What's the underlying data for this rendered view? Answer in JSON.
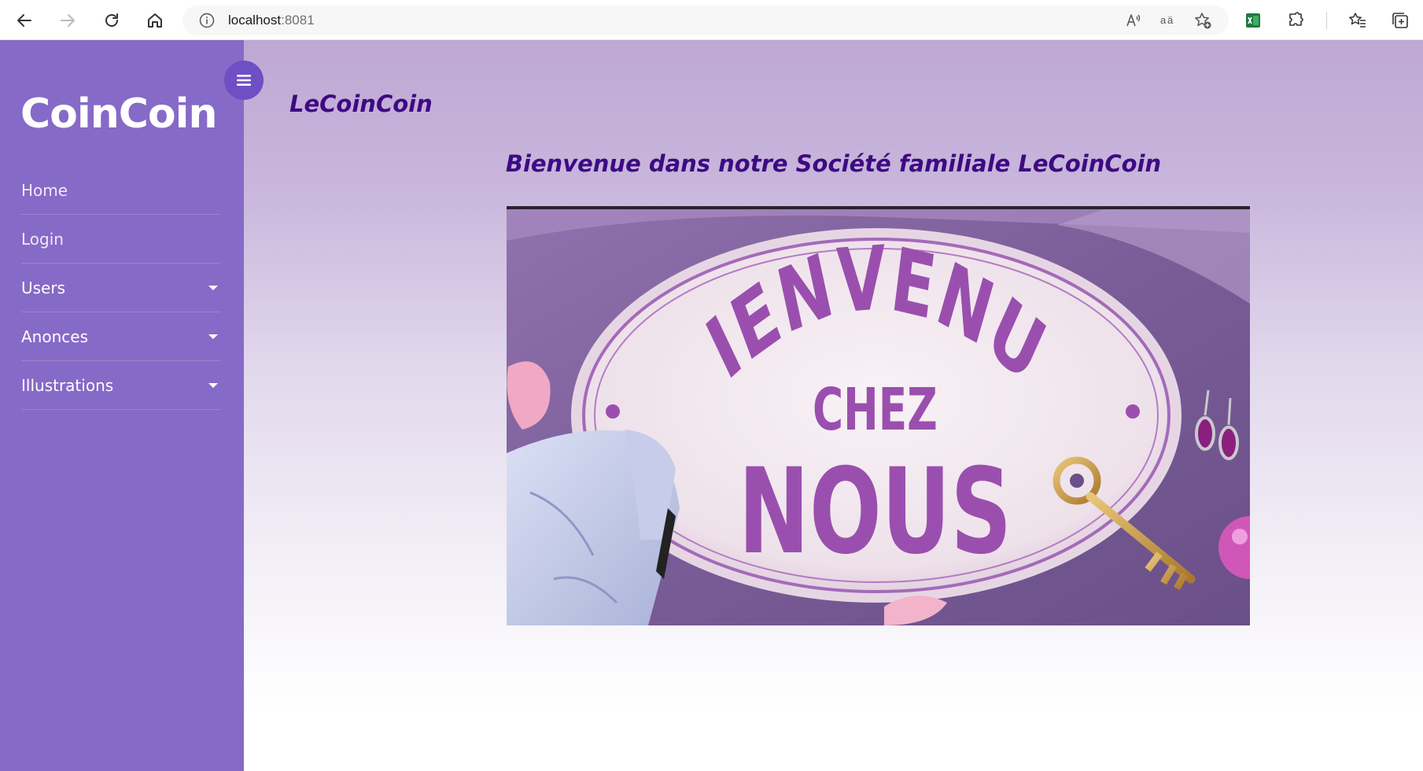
{
  "browser": {
    "url_host": "localhost",
    "url_port": ":8081",
    "read_aloud_label": "A’’",
    "translate_label": "aä"
  },
  "sidebar": {
    "brand": "CoinCoin",
    "items": [
      {
        "label": "Home",
        "has_dropdown": false
      },
      {
        "label": "Login",
        "has_dropdown": false
      },
      {
        "label": "Users",
        "has_dropdown": true
      },
      {
        "label": "Anonces",
        "has_dropdown": true
      },
      {
        "label": "Illustrations",
        "has_dropdown": true
      }
    ]
  },
  "main": {
    "site_title": "LeCoinCoin",
    "welcome": "Bienvenue dans notre Société familiale LeCoinCoin",
    "hero": {
      "line1": "BIENVENUE",
      "line2": "CHEZ",
      "line3": "NOUS"
    }
  },
  "colors": {
    "sidebar_bg": "#866ac7",
    "toggle_bg": "#6f4fc4",
    "heading_text": "#3e0a82",
    "hero_letters": "#9a4fae"
  }
}
